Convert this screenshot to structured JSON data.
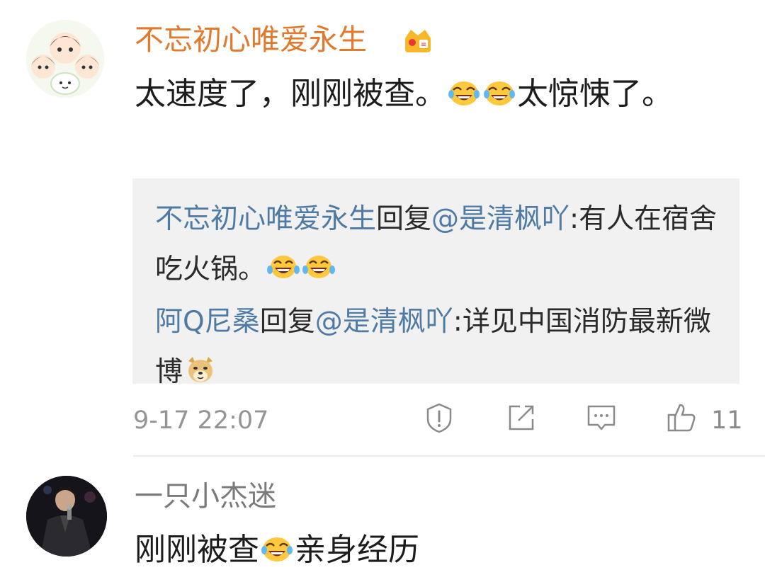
{
  "comment1": {
    "username": "不忘初心唯爱永生",
    "text_a": "太速度了，刚刚被查。",
    "text_b": "太惊悚了。",
    "replies": [
      {
        "user": "不忘初心唯爱永生",
        "verb": "回复",
        "target": "@是清枫吖",
        "text": ":有人在宿舍吃火锅。"
      },
      {
        "user": "阿Q尼桑",
        "verb": "回复",
        "target": "@是清枫吖",
        "text": ":详见中国消防最新微博"
      }
    ],
    "timestamp": "9-17 22:07",
    "like_count": "11"
  },
  "comment2": {
    "username": "一只小杰迷",
    "text_a": "刚刚被查",
    "text_b": "亲身经历"
  },
  "icons": [
    "crown-vip-icon",
    "laugh-cry-emoji",
    "doge-emoji",
    "report-icon",
    "share-icon",
    "comment-icon",
    "like-icon"
  ],
  "colors": {
    "username_vip": "#e2792d",
    "reply_user": "#4f7aa3",
    "reply_bg": "#f1f1f1",
    "meta": "#959595"
  }
}
